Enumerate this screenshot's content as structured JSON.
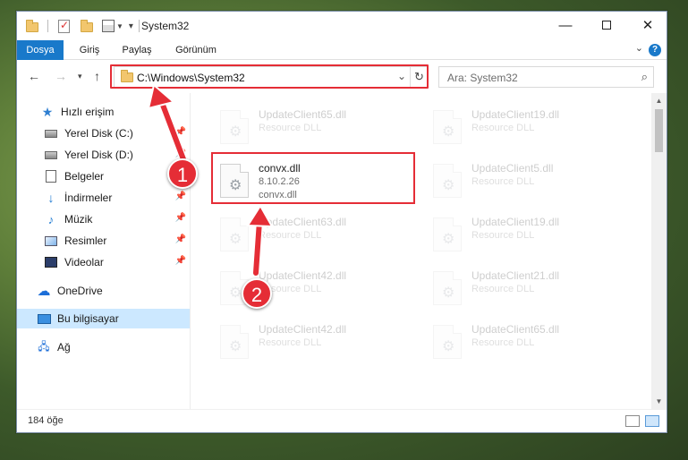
{
  "window": {
    "title": "System32",
    "minimize_icon": "minimize-icon",
    "maximize_icon": "maximize-icon",
    "close_icon": "close-icon"
  },
  "ribbon": {
    "tabs": [
      {
        "label": "Dosya"
      },
      {
        "label": "Giriş"
      },
      {
        "label": "Paylaş"
      },
      {
        "label": "Görünüm"
      }
    ]
  },
  "navbar": {
    "address": "C:\\Windows\\System32",
    "search_placeholder": "Ara: System32"
  },
  "sidebar": {
    "items": [
      {
        "label": "Hızlı erişim",
        "icon": "star-icon",
        "pinned": false
      },
      {
        "label": "Yerel Disk (C:)",
        "icon": "drive-icon",
        "pinned": true
      },
      {
        "label": "Yerel Disk (D:)",
        "icon": "drive-icon",
        "pinned": true
      },
      {
        "label": "Belgeler",
        "icon": "documents-icon",
        "pinned": true
      },
      {
        "label": "İndirmeler",
        "icon": "downloads-icon",
        "pinned": true
      },
      {
        "label": "Müzik",
        "icon": "music-icon",
        "pinned": true
      },
      {
        "label": "Resimler",
        "icon": "pictures-icon",
        "pinned": true
      },
      {
        "label": "Videolar",
        "icon": "videos-icon",
        "pinned": true
      },
      {
        "label": "OneDrive",
        "icon": "cloud-icon",
        "pinned": false
      },
      {
        "label": "Bu bilgisayar",
        "icon": "computer-icon",
        "pinned": false,
        "selected": true
      },
      {
        "label": "Ağ",
        "icon": "network-icon",
        "pinned": false
      }
    ]
  },
  "files": {
    "left": [
      {
        "name": "UpdateClient65.dll",
        "type": "Resource DLL"
      },
      {
        "name": "convx.dll",
        "version": "8.10.2.26",
        "desc": "convx.dll",
        "highlighted": true
      },
      {
        "name": "UpdateClient63.dll",
        "type": "Resource DLL"
      },
      {
        "name": "UpdateClient42.dll",
        "type": "Resource DLL"
      },
      {
        "name": "UpdateClient42.dll",
        "type": "Resource DLL"
      }
    ],
    "right": [
      {
        "name": "UpdateClient19.dll",
        "type": "Resource DLL"
      },
      {
        "name": "UpdateClient5.dll",
        "type": "Resource DLL"
      },
      {
        "name": "UpdateClient19.dll",
        "type": "Resource DLL"
      },
      {
        "name": "UpdateClient21.dll",
        "type": "Resource DLL"
      },
      {
        "name": "UpdateClient65.dll",
        "type": "Resource DLL"
      }
    ]
  },
  "status": {
    "item_count": "184 öğe"
  },
  "annotations": {
    "step1": "1",
    "step2": "2",
    "color": "#e52d36"
  },
  "colors": {
    "accent": "#1979ca",
    "selection": "#cce8ff"
  }
}
